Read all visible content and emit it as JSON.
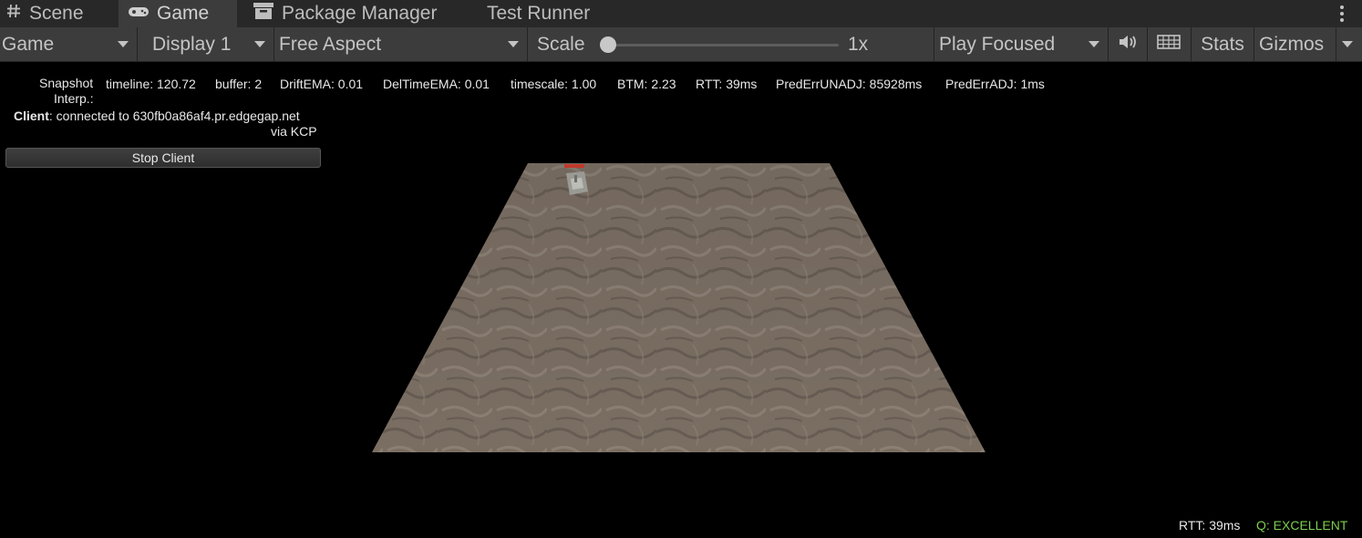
{
  "tabs": {
    "scene": "Scene",
    "game": "Game",
    "package_manager": "Package Manager",
    "test_runner": "Test Runner"
  },
  "toolbar": {
    "view_mode": "Game",
    "display": "Display 1",
    "aspect": "Free Aspect",
    "scale_label": "Scale",
    "scale_value": "1x",
    "scale_fraction": 0.0,
    "play_mode": "Play Focused",
    "stats": "Stats",
    "gizmos": "Gizmos"
  },
  "overlay": {
    "snapshot_label_1": "Snapshot",
    "snapshot_label_2": "Interp.:",
    "timeline": "timeline: 120.72",
    "buffer": "buffer: 2",
    "drift": "DriftEMA: 0.01",
    "deltime": "DelTimeEMA: 0.01",
    "timescale": "timescale: 1.00",
    "btm": "BTM: 2.23",
    "rtt": "RTT: 39ms",
    "pred_unadj": "PredErrUNADJ: 85928ms",
    "pred_adj": "PredErrADJ: 1ms",
    "client_label": "Client",
    "client_text": ": connected to 630fb0a86af4.pr.edgegap.net",
    "client_via": "via KCP",
    "stop_client": "Stop Client"
  },
  "hud": {
    "rtt": "RTT: 39ms",
    "quality": "Q: EXCELLENT"
  },
  "colors": {
    "tab_strip_bg": "#282828",
    "toolbar_bg": "#3c3c3c",
    "game_bg": "#000000",
    "quality_green": "#7ccf4d",
    "ground": "#7a6e63"
  },
  "icons": {
    "scene": "hash-icon",
    "game": "gamepad-icon",
    "package_manager": "package-icon",
    "menu": "kebab-menu-icon",
    "audio": "speaker-icon",
    "shortcuts": "keyboard-icon"
  }
}
